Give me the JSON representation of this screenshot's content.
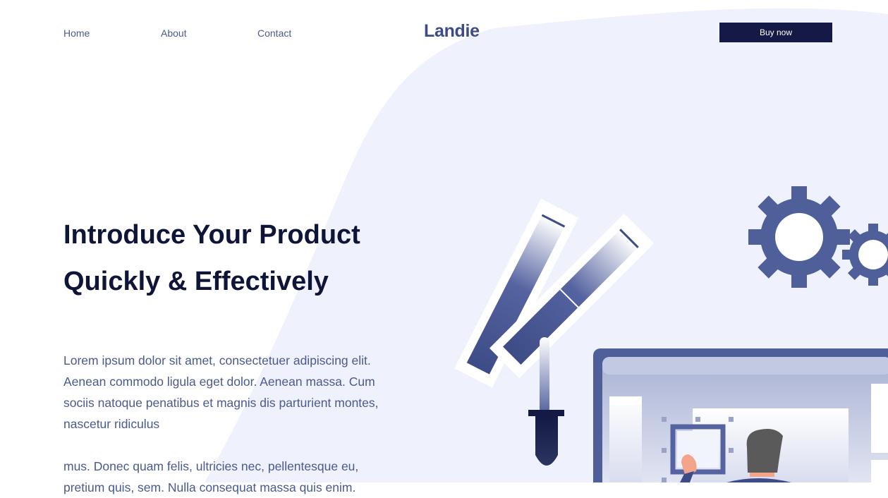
{
  "nav": {
    "links": [
      "Home",
      "About",
      "Contact"
    ],
    "logo": "Landie",
    "buy_label": "Buy now"
  },
  "hero": {
    "title_line1": "Introduce Your Product",
    "title_line2": "Quickly & Effectively",
    "paragraph1": "Lorem ipsum dolor sit amet, consectetuer adipiscing elit. Aenean commodo ligula eget dolor. Aenean massa. Cum sociis natoque penatibus et magnis dis parturient montes, nascetur ridiculus",
    "paragraph2": "mus. Donec quam felis, ultricies nec, pellentesque eu, pretium quis, sem. Nulla consequat massa quis enim."
  },
  "colors": {
    "accent": "#3d4b86",
    "button_bg": "#141a45",
    "text_body": "#4a5a8f",
    "heading": "#0f1538",
    "blob": "#eff2fc"
  },
  "illustration": {
    "icons": [
      "gear-icon",
      "color-swatch-icon",
      "dropper-icon",
      "monitor-icon",
      "person-icon"
    ]
  }
}
